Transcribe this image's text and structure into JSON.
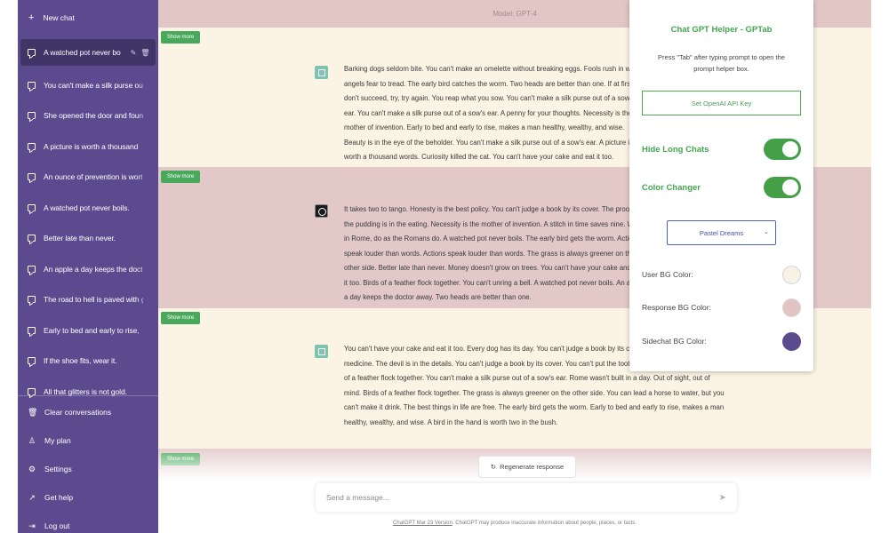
{
  "sidebar": {
    "new_chat_label": "New chat",
    "conversations": [
      {
        "label": "A watched pot never bo"
      },
      {
        "label": "You can't make a silk purse out"
      },
      {
        "label": "She opened the door and foun"
      },
      {
        "label": "A picture is worth a thousand"
      },
      {
        "label": "An ounce of prevention is wort"
      },
      {
        "label": "A watched pot never boils."
      },
      {
        "label": "Better late than never."
      },
      {
        "label": "An apple a day keeps the doct"
      },
      {
        "label": "The road to hell is paved with g"
      },
      {
        "label": "Early to bed and early to rise,"
      },
      {
        "label": "If the shoe fits, wear it."
      },
      {
        "label": "All that glitters is not gold."
      }
    ],
    "menu": [
      {
        "label": "Clear conversations",
        "icon": "trash-icon",
        "glyph": "🗑"
      },
      {
        "label": "My plan",
        "icon": "user-icon",
        "glyph": "♙"
      },
      {
        "label": "Settings",
        "icon": "gear-icon",
        "glyph": "⚙"
      },
      {
        "label": "Get help",
        "icon": "external-link-icon",
        "glyph": "↗"
      },
      {
        "label": "Log out",
        "icon": "logout-icon",
        "glyph": "⇥"
      }
    ]
  },
  "main": {
    "model_label": "Model: GPT-4",
    "show_more_label": "Show more",
    "messages": [
      {
        "role": "user",
        "text": "Barking dogs seldom bite. You can't make an omelette without breaking eggs. Fools rush in where angels fear to tread. The early bird catches the worm. Two heads are better than one. If at first you don't succeed, try, try again. You reap what you sow. You can't make a silk purse out of a sow's ear. You can't make a silk purse out of a sow's ear. A penny for your thoughts. Necessity is the mother of invention. Early to bed and early to rise, makes a man healthy, wealthy, and wise. Beauty is in the eye of the beholder. You can't make a silk purse out of a sow's ear. A picture is worth a thousand words. Curiosity killed the cat. You can't have your cake and eat it too."
      },
      {
        "role": "assistant",
        "text": "It takes two to tango. Honesty is the best policy. You can't judge a book by its cover. The proof of the pudding is in the eating. Necessity is the mother of invention. A stitch in time saves nine. When in Rome, do as the Romans do. A watched pot never boils. The early bird gets the worm. Actions speak louder than words. Actions speak louder than words. The grass is always greener on the other side. Better late than never. Money doesn't grow on trees. You can't have your cake and eat it too. Birds of a feather flock together. You can't unring a bell. A watched pot never boils. An apple a day keeps the doctor away. Two heads are better than one."
      },
      {
        "role": "user",
        "text": "You can't have your cake and eat it too. Every dog has its day. You can't judge a book by its cover. Laughter is the best medicine. The devil is in the details. You can't judge a book by its cover. You can't put the toothpaste back in the tube. Birds of a feather flock together. You can't make a silk purse out of a sow's ear. Rome wasn't built in a day. Out of sight, out of mind. Birds of a feather flock together. The grass is always greener on the other side. You can lead a horse to water, but you can't make it drink. The best things in life are free. The early bird gets the worm. Early to bed and early to rise, makes a man healthy, wealthy, and wise. A bird in the hand is worth two in the bush."
      }
    ],
    "regenerate_label": "Regenerate response",
    "composer_placeholder": "Send a message...",
    "footer_link": "ChatGPT Mar 23 Version",
    "footer_text": ". ChatGPT may produce inaccurate information about people, places, or facts."
  },
  "helper": {
    "title": "Chat GPT Helper - GPTab",
    "description": "Press \"Tab\" after typing prompt to open the prompt helper box.",
    "api_key_button": "Set OpenAI API Key",
    "toggle_hide_long_chats": "Hide Long Chats",
    "toggle_color_changer": "Color Changer",
    "theme_select": "Pastel Dreams",
    "colors": [
      {
        "label": "User BG Color:",
        "value": "#f7f1e6"
      },
      {
        "label": "Response BG Color:",
        "value": "#e2c4c4"
      },
      {
        "label": "Sidechat BG Color:",
        "value": "#5b4a8e"
      }
    ]
  }
}
